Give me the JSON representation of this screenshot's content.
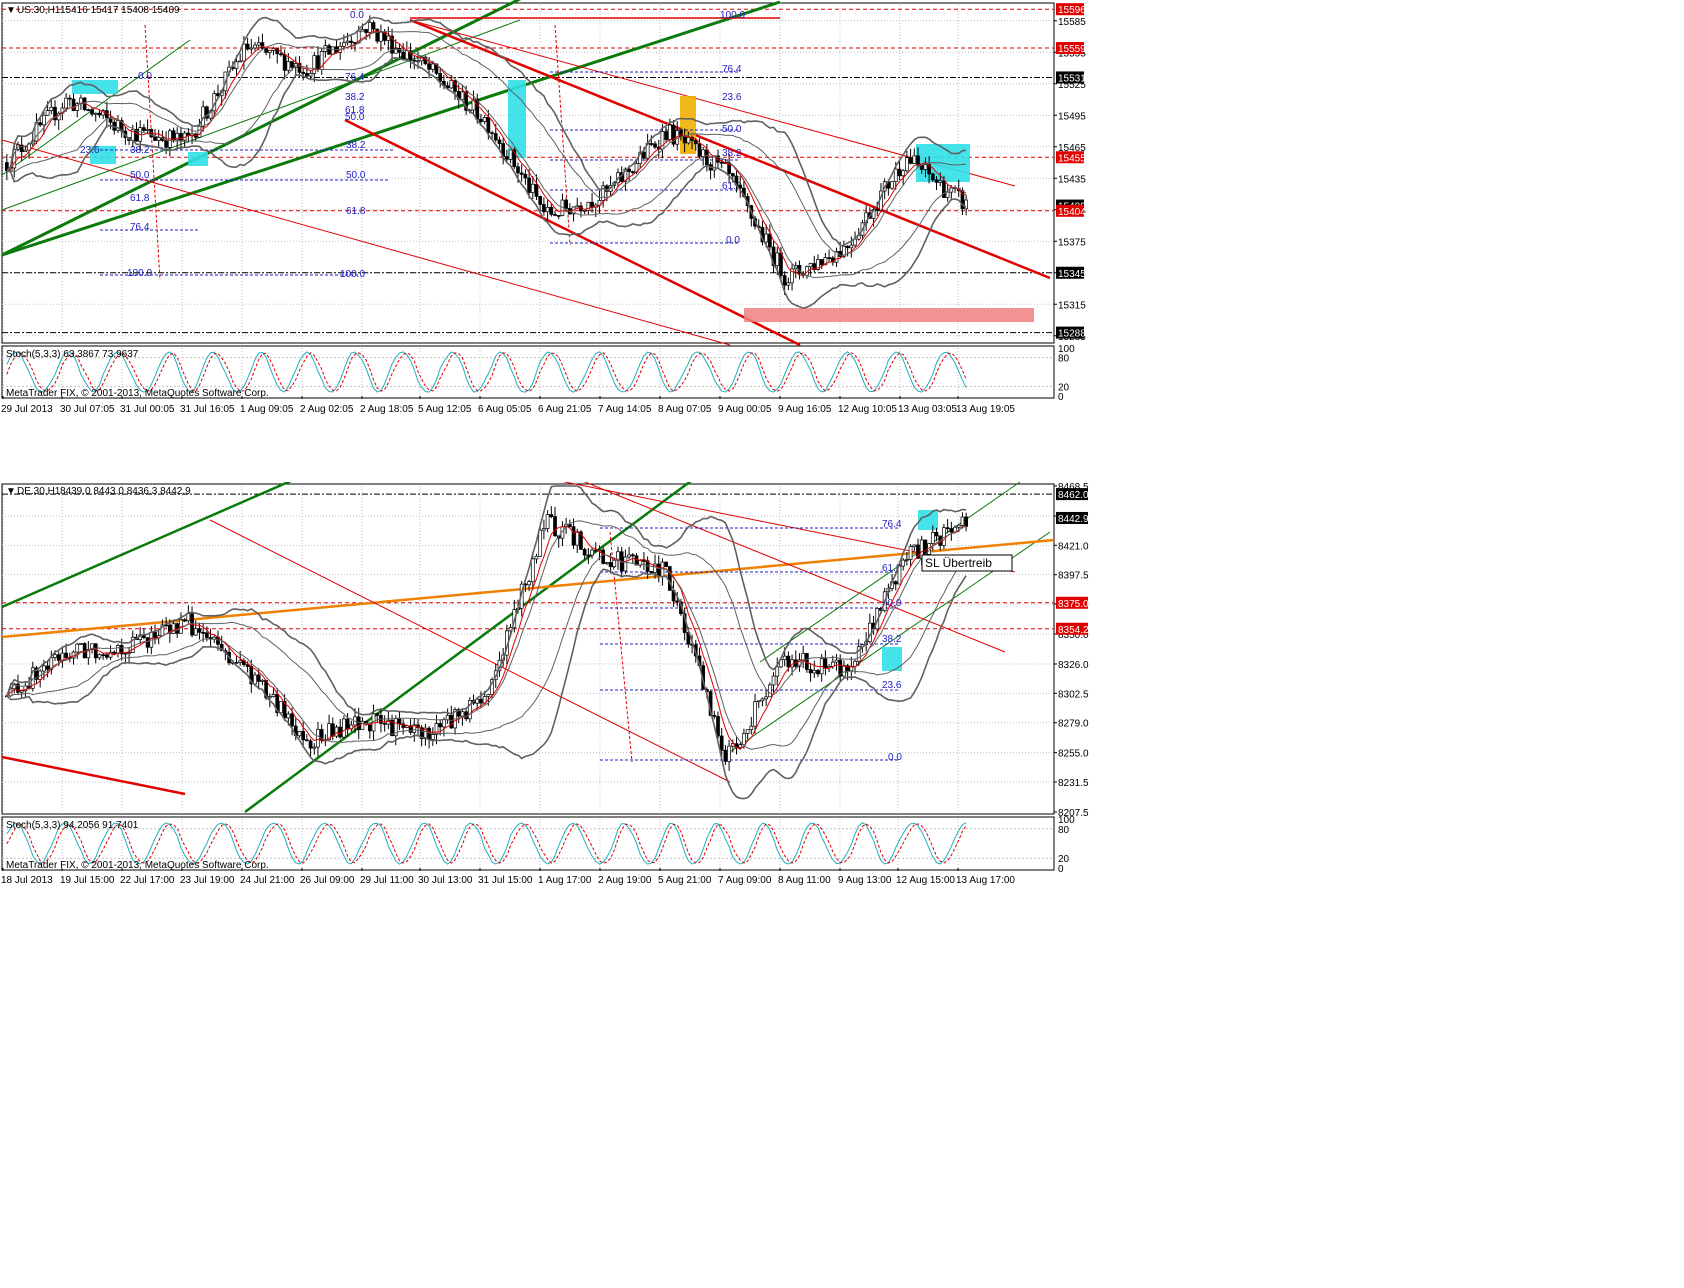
{
  "charts": [
    {
      "id": "us30",
      "header": {
        "symbol": "US.30,H1",
        "ohlc": "15416 15417 15408 15409"
      },
      "indicator_label": "Stoch(5,3,3) 63.3867 73.9637",
      "copyright": "MetaTrader FIX, © 2001-2013, MetaQuotes Software Corp.",
      "price_ticks": [
        "15585",
        "15555",
        "15525",
        "15495",
        "15465",
        "15435",
        "15405",
        "15375",
        "15345",
        "15315",
        "15285"
      ],
      "price_tags": [
        {
          "text": "15596",
          "color": "#e00000"
        },
        {
          "text": "15559",
          "color": "#e00000"
        },
        {
          "text": "15531",
          "color": "#000000"
        },
        {
          "text": "15455",
          "color": "#e00000"
        },
        {
          "text": "15409",
          "color": "#000000"
        },
        {
          "text": "15404",
          "color": "#e00000"
        },
        {
          "text": "15345",
          "color": "#000000"
        },
        {
          "text": "15288",
          "color": "#000000"
        }
      ],
      "stoch_ticks": [
        "100",
        "80",
        "20",
        "0"
      ],
      "time_labels": [
        "29 Jul 2013",
        "30 Jul 07:05",
        "31 Jul 00:05",
        "31 Jul 16:05",
        "1 Aug 09:05",
        "2 Aug 02:05",
        "2 Aug 18:05",
        "5 Aug 12:05",
        "6 Aug 05:05",
        "6 Aug 21:05",
        "7 Aug 14:05",
        "8 Aug 07:05",
        "9 Aug 00:05",
        "9 Aug 16:05",
        "12 Aug 10:05",
        "13 Aug 03:05",
        "13 Aug 19:05"
      ],
      "fib_labels": [
        "0.0",
        "100.0",
        "76.4",
        "61.8",
        "50.0",
        "38.2",
        "23.6",
        "0.0",
        "61.8",
        "50.0",
        "38.2",
        "0.0",
        "61.8",
        "50.0",
        "38.2",
        "23.6",
        "76.4",
        "100.0",
        "76.4",
        "61.8",
        "50.0",
        "38.2",
        "100.0"
      ]
    },
    {
      "id": "de30",
      "header": {
        "symbol": "DE.30,H1",
        "ohlc": "8439.0 8443.0 8436.3 8442.9"
      },
      "indicator_label": "Stoch(5,3,3) 94.2056 91.7401",
      "copyright": "MetaTrader FIX, © 2001-2013, MetaQuotes Software Corp.",
      "price_ticks": [
        "8468.5",
        "8444.5",
        "8421.0",
        "8397.5",
        "8374.0",
        "8350.0",
        "8326.0",
        "8302.5",
        "8279.0",
        "8255.0",
        "8231.5",
        "8207.5"
      ],
      "price_tags": [
        {
          "text": "8462.0",
          "color": "#000000"
        },
        {
          "text": "8442.9",
          "color": "#000000"
        },
        {
          "text": "8375.0",
          "color": "#e00000"
        },
        {
          "text": "8354.2",
          "color": "#e00000"
        }
      ],
      "stoch_ticks": [
        "100",
        "80",
        "20",
        "0"
      ],
      "time_labels": [
        "18 Jul 2013",
        "19 Jul 15:00",
        "22 Jul 17:00",
        "23 Jul 19:00",
        "24 Jul 21:00",
        "26 Jul 09:00",
        "29 Jul 11:00",
        "30 Jul 13:00",
        "31 Jul 15:00",
        "1 Aug 17:00",
        "2 Aug 19:00",
        "5 Aug 21:00",
        "7 Aug 09:00",
        "8 Aug 11:00",
        "9 Aug 13:00",
        "12 Aug 15:00",
        "13 Aug 17:00"
      ],
      "fib_labels": [
        "100.0",
        "76.4",
        "61.8",
        "50.0",
        "38.2",
        "23.6",
        "0.0"
      ],
      "annotation": "SL Übertreib"
    }
  ],
  "chart_data": [
    {
      "type": "candlestick",
      "title": "US.30,H1",
      "ylim": [
        15280,
        15600
      ],
      "horizontal_levels": [
        15596,
        15559,
        15531,
        15455,
        15404,
        15345,
        15288
      ],
      "last_price": 15409,
      "indicator": {
        "name": "Stoch(5,3,3)",
        "main": 63.3867,
        "signal": 73.9637,
        "levels": [
          20,
          80
        ]
      },
      "x": [
        "29 Jul 2013",
        "30 Jul 07:05",
        "31 Jul 00:05",
        "31 Jul 16:05",
        "1 Aug 09:05",
        "2 Aug 02:05",
        "2 Aug 18:05",
        "5 Aug 12:05",
        "6 Aug 05:05",
        "6 Aug 21:05",
        "7 Aug 14:05",
        "8 Aug 07:05",
        "9 Aug 00:05",
        "9 Aug 16:05",
        "12 Aug 10:05",
        "13 Aug 03:05",
        "13 Aug 19:05"
      ],
      "close_approx": [
        15450,
        15510,
        15480,
        15470,
        15560,
        15540,
        15580,
        15540,
        15490,
        15400,
        15420,
        15480,
        15440,
        15340,
        15370,
        15455,
        15409
      ]
    },
    {
      "type": "candlestick",
      "title": "DE.30,H1",
      "ylim": [
        8207.5,
        8468.5
      ],
      "horizontal_levels": [
        8462.0,
        8375.0,
        8354.2
      ],
      "last_price": 8442.9,
      "indicator": {
        "name": "Stoch(5,3,3)",
        "main": 94.2056,
        "signal": 91.7401,
        "levels": [
          20,
          80
        ]
      },
      "x": [
        "18 Jul 2013",
        "19 Jul 15:00",
        "22 Jul 17:00",
        "23 Jul 19:00",
        "24 Jul 21:00",
        "26 Jul 09:00",
        "29 Jul 11:00",
        "30 Jul 13:00",
        "31 Jul 15:00",
        "1 Aug 17:00",
        "2 Aug 19:00",
        "5 Aug 21:00",
        "7 Aug 09:00",
        "8 Aug 11:00",
        "9 Aug 13:00",
        "12 Aug 15:00",
        "13 Aug 17:00"
      ],
      "close_approx": [
        8300,
        8335,
        8340,
        8360,
        8320,
        8265,
        8280,
        8270,
        8300,
        8440,
        8410,
        8400,
        8250,
        8330,
        8320,
        8410,
        8442.9
      ]
    }
  ]
}
